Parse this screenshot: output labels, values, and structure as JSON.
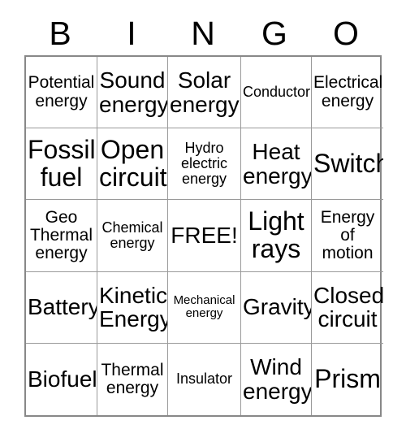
{
  "card": {
    "type": "bingo-card",
    "title_letters": [
      "B",
      "I",
      "N",
      "G",
      "O"
    ],
    "columns": 5,
    "rows": 5,
    "free_space": "FREE!",
    "colors": {
      "background": "#ffffff",
      "text": "#000000",
      "gridline": "#9a9a9a",
      "outer_border": "#888888"
    },
    "cells": [
      {
        "text": "Potential\nenergy",
        "size": "m"
      },
      {
        "text": "Sound\nenergy",
        "size": "xl"
      },
      {
        "text": "Solar\nenergy",
        "size": "xl"
      },
      {
        "text": "Conductor",
        "size": "s"
      },
      {
        "text": "Electrical\nenergy",
        "size": "m"
      },
      {
        "text": "Fossil\nfuel",
        "size": "xxl"
      },
      {
        "text": "Open\ncircuit",
        "size": "xxl"
      },
      {
        "text": "Hydro\nelectric\nenergy",
        "size": "s"
      },
      {
        "text": "Heat\nenergy",
        "size": "xl"
      },
      {
        "text": "Switch",
        "size": "xxl"
      },
      {
        "text": "Geo\nThermal\nenergy",
        "size": "m"
      },
      {
        "text": "Chemical\nenergy",
        "size": "s"
      },
      {
        "text": "FREE!",
        "size": "xl"
      },
      {
        "text": "Light\nrays",
        "size": "xxl"
      },
      {
        "text": "Energy\nof\nmotion",
        "size": "m"
      },
      {
        "text": "Battery",
        "size": "xl"
      },
      {
        "text": "Kinetic\nEnergy",
        "size": "xl"
      },
      {
        "text": "Mechanical\nenergy",
        "size": "xs"
      },
      {
        "text": "Gravity",
        "size": "xl"
      },
      {
        "text": "Closed\ncircuit",
        "size": "xl"
      },
      {
        "text": "Biofuel",
        "size": "xl"
      },
      {
        "text": "Thermal\nenergy",
        "size": "m"
      },
      {
        "text": "Insulator",
        "size": "s"
      },
      {
        "text": "Wind\nenergy",
        "size": "xl"
      },
      {
        "text": "Prism",
        "size": "xxl"
      }
    ]
  }
}
